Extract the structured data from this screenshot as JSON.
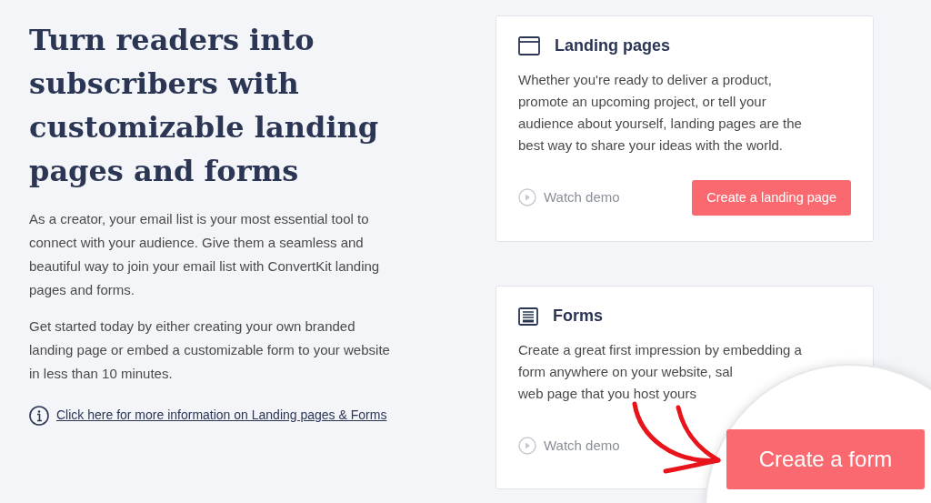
{
  "hero": {
    "title": "Turn readers into subscribers with customizable landing pages and forms",
    "paragraphs": [
      "As a creator, your email list is your most essential tool to connect with your audience. Give them a seamless and beautiful way to join your email list with ConvertKit landing pages and forms.",
      "Get started today by either creating your own branded landing page or embed a customizable form to your website in less than 10 minutes."
    ],
    "info_link": "Click here for more information on Landing pages & Forms"
  },
  "cards": [
    {
      "kind": "landing",
      "title": "Landing pages",
      "description_lines": [
        "Whether you're ready to deliver a product,",
        "promote an upcoming project, or tell your",
        "audience about yourself, landing pages are the",
        "best way to share your ideas with the world."
      ],
      "demo_link": "Watch demo",
      "action": "Create a landing page"
    },
    {
      "kind": "form",
      "title": "Forms",
      "description_lines": [
        "Create a great first impression by embedding a",
        "form anywhere on your website, sal",
        "web page that you host yours"
      ],
      "demo_link": "Watch demo"
    }
  ],
  "magnifier": {
    "action": "Create a form"
  }
}
